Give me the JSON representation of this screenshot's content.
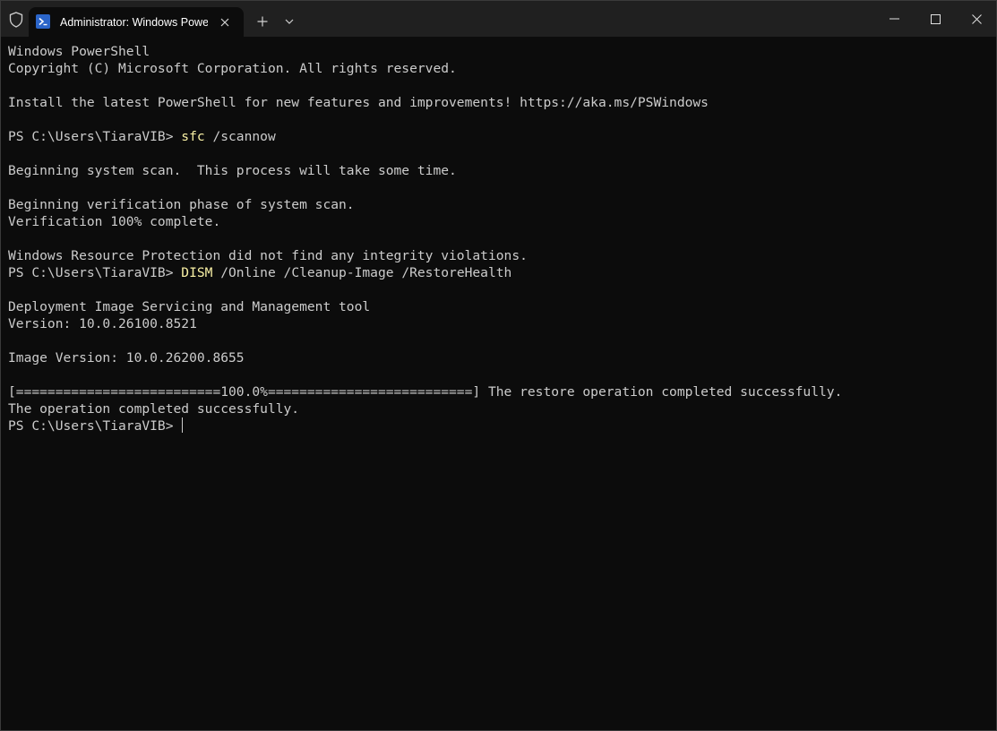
{
  "window": {
    "tab_title": "Administrator: Windows PowerShell",
    "icons": {
      "shield": "shield-icon",
      "tab": "powershell-icon",
      "tab_close": "close-icon",
      "new_tab": "plus-icon",
      "dropdown": "chevron-down-icon",
      "minimize": "minimize-icon",
      "maximize": "maximize-icon",
      "close": "close-icon"
    },
    "colors": {
      "background": "#0c0c0c",
      "titlebar": "#202020",
      "text": "#cccccc",
      "command": "#f9f1a5"
    }
  },
  "terminal": {
    "lines": [
      {
        "text": "Windows PowerShell"
      },
      {
        "text": "Copyright (C) Microsoft Corporation. All rights reserved."
      },
      {
        "text": ""
      },
      {
        "text": "Install the latest PowerShell for new features and improvements! https://aka.ms/PSWindows"
      },
      {
        "text": ""
      },
      {
        "prompt": "PS C:\\Users\\TiaraVIB> ",
        "cmd": "sfc",
        "args": " /scannow"
      },
      {
        "text": ""
      },
      {
        "text": "Beginning system scan.  This process will take some time."
      },
      {
        "text": ""
      },
      {
        "text": "Beginning verification phase of system scan."
      },
      {
        "text": "Verification 100% complete."
      },
      {
        "text": ""
      },
      {
        "text": "Windows Resource Protection did not find any integrity violations."
      },
      {
        "prompt": "PS C:\\Users\\TiaraVIB> ",
        "cmd": "DISM",
        "args": " /Online /Cleanup-Image /RestoreHealth"
      },
      {
        "text": ""
      },
      {
        "text": "Deployment Image Servicing and Management tool"
      },
      {
        "text": "Version: 10.0.26100.8521"
      },
      {
        "text": ""
      },
      {
        "text": "Image Version: 10.0.26200.8655"
      },
      {
        "text": ""
      },
      {
        "text": "[==========================100.0%==========================] The restore operation completed successfully."
      },
      {
        "text": "The operation completed successfully."
      },
      {
        "prompt": "PS C:\\Users\\TiaraVIB> ",
        "cursor": true
      }
    ]
  }
}
